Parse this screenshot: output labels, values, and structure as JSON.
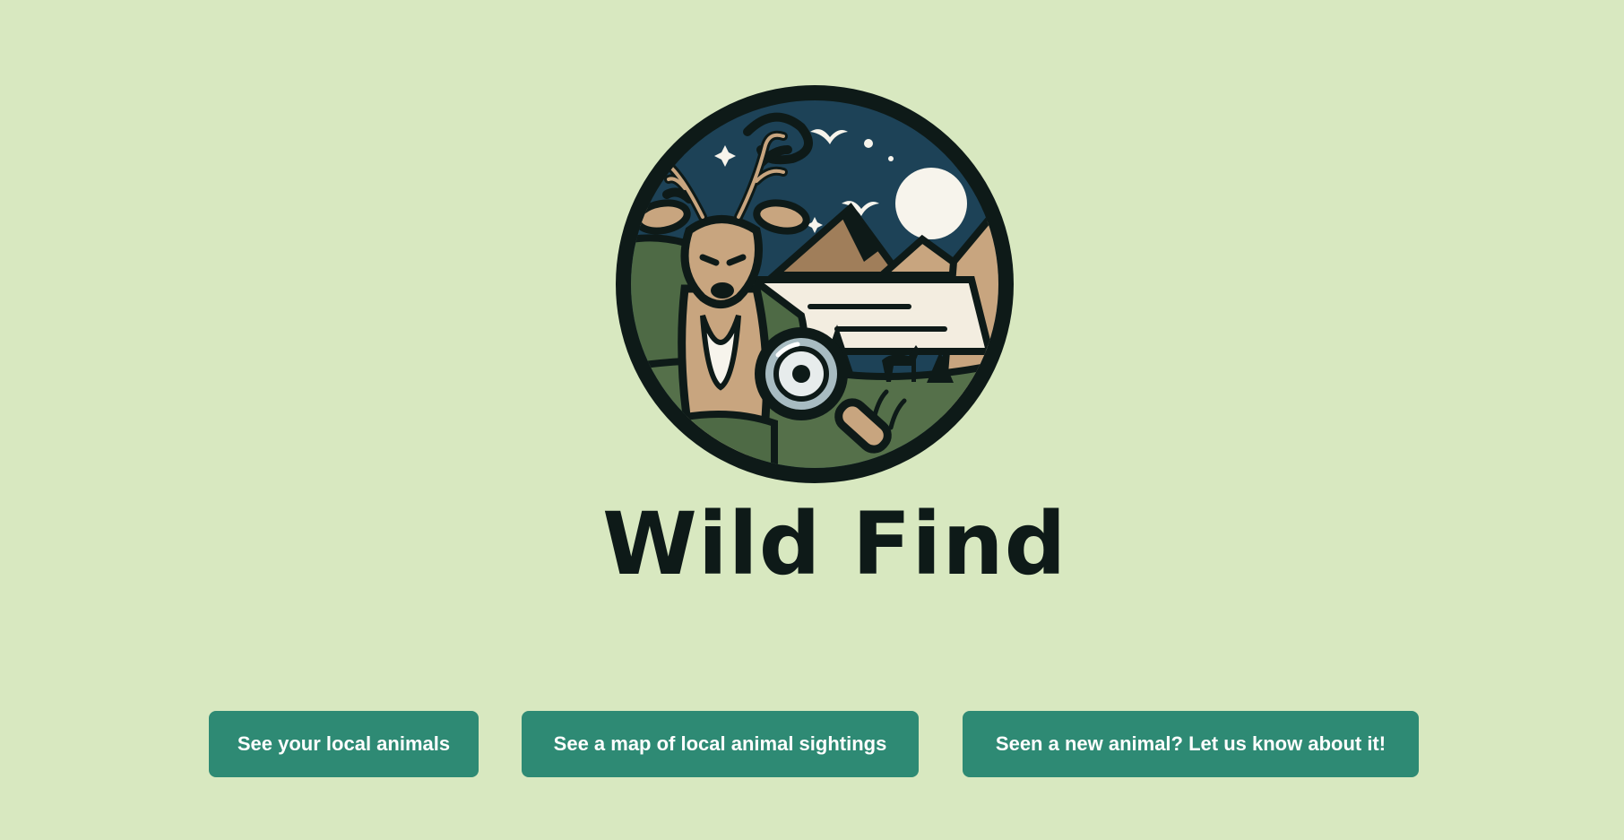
{
  "app": {
    "logo_text": "Wild Find",
    "logo_emblem_name": "deer-landscape-magnifier-emblem"
  },
  "actions": [
    {
      "label": "See your local animals"
    },
    {
      "label": "See a map of local animal sightings"
    },
    {
      "label": "Seen a new animal? Let us know about it!"
    }
  ],
  "colors": {
    "background": "#d8e8c0",
    "button": "#2e8a74",
    "button_text": "#ffffff",
    "logo_dark": "#0e1a18",
    "sky": "#1d4257",
    "hills": "#4e6a45",
    "deer": "#c8a57f"
  }
}
